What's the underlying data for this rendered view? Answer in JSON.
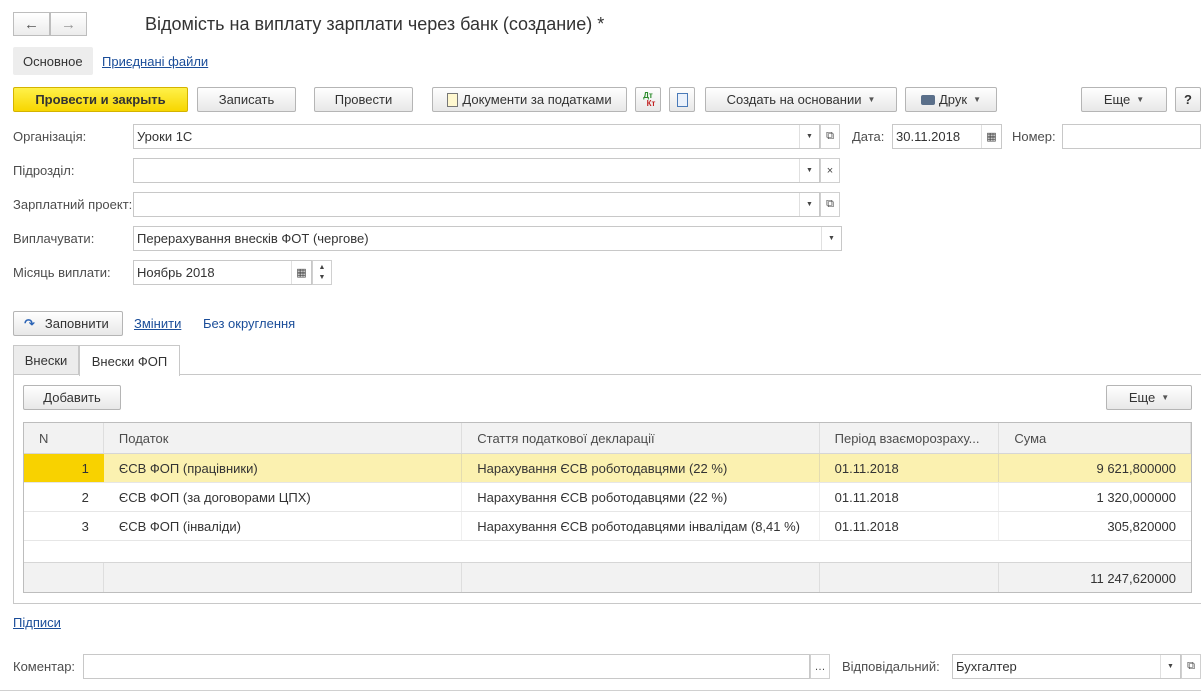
{
  "window": {
    "title": "Відомість на виплату зарплати через банк (создание) *",
    "nav_back": "←",
    "nav_forward": "→"
  },
  "tabs_main": [
    "Основное",
    "Приєднані файли"
  ],
  "toolbar": {
    "post_close": "Провести и закрыть",
    "save": "Записать",
    "post": "Провести",
    "tax_docs": "Документи за податками",
    "dt_kt_top": "Дт",
    "dt_kt_bottom": "Кт",
    "create_based": "Создать на основании",
    "print": "Друк",
    "more": "Еще",
    "help": "?"
  },
  "form": {
    "org_label": "Організація:",
    "org_value": "Уроки 1С",
    "date_label": "Дата:",
    "date_value": "30.11.2018",
    "number_label": "Номер:",
    "number_value": "",
    "dept_label": "Підрозділ:",
    "dept_value": "",
    "project_label": "Зарплатний проект:",
    "project_value": "",
    "pay_label": "Виплачувати:",
    "pay_value": "Перерахування внесків ФОТ (чергове)",
    "month_label": "Місяць виплати:",
    "month_value": "Ноябрь 2018"
  },
  "actions": {
    "fill": "Заповнити",
    "change": "Змінити",
    "no_rounding": "Без округлення"
  },
  "subtabs": [
    "Внески",
    "Внески ФОП"
  ],
  "table_toolbar": {
    "add": "Добавить",
    "more": "Еще"
  },
  "table": {
    "headers": [
      "N",
      "Податок",
      "Стаття податкової декларації",
      "Період взаєморозраху...",
      "Сума"
    ],
    "rows": [
      {
        "n": "1",
        "tax": "ЄСВ ФОП (працівники)",
        "article": "Нарахування ЄСВ роботодавцями (22 %)",
        "period": "01.11.2018",
        "sum": "9 621,800000"
      },
      {
        "n": "2",
        "tax": "ЄСВ ФОП (за договорами ЦПХ)",
        "article": "Нарахування ЄСВ роботодавцями (22 %)",
        "period": "01.11.2018",
        "sum": "1 320,000000"
      },
      {
        "n": "3",
        "tax": "ЄСВ ФОП (інваліди)",
        "article": "Нарахування ЄСВ роботодавцями інвалідам (8,41 %)",
        "period": "01.11.2018",
        "sum": "305,820000"
      }
    ],
    "total": "11 247,620000"
  },
  "footer": {
    "signatures": "Підписи",
    "comment_label": "Коментар:",
    "comment_value": "",
    "responsible_label": "Відповідальний:",
    "responsible_value": "Бухгалтер"
  },
  "colors": {
    "primary_button": "#f7d600",
    "selected_row": "#fbf1b0",
    "link": "#1a4d99"
  }
}
